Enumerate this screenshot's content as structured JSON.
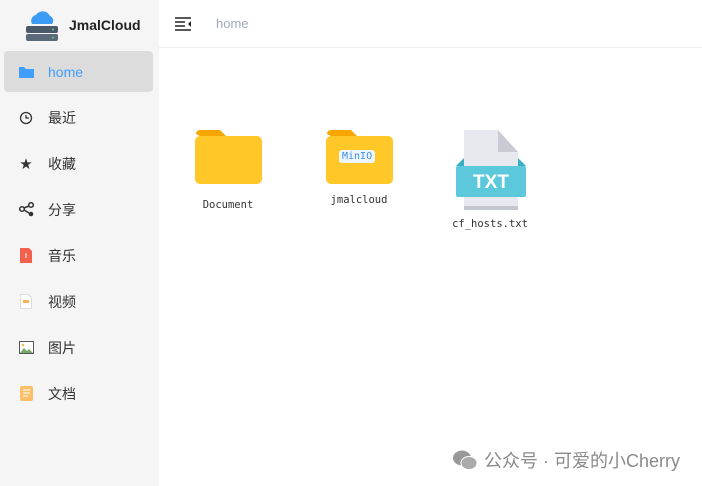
{
  "app": {
    "title": "JmalCloud"
  },
  "header": {
    "breadcrumb": "home"
  },
  "sidebar": {
    "items": [
      {
        "label": "home",
        "icon": "folder-icon"
      },
      {
        "label": "最近",
        "icon": "clock-icon"
      },
      {
        "label": "收藏",
        "icon": "star-icon"
      },
      {
        "label": "分享",
        "icon": "share-icon"
      },
      {
        "label": "音乐",
        "icon": "music-file-icon"
      },
      {
        "label": "视频",
        "icon": "video-file-icon"
      },
      {
        "label": "图片",
        "icon": "image-icon"
      },
      {
        "label": "文档",
        "icon": "document-icon"
      }
    ]
  },
  "files": [
    {
      "name": "Document",
      "type": "folder"
    },
    {
      "name": "jmalcloud",
      "type": "folder",
      "badge": "MinIO"
    },
    {
      "name": "cf_hosts.txt",
      "type": "txt",
      "badge": "TXT"
    }
  ],
  "watermark": "公众号 · 可爱的小Cherry",
  "colors": {
    "accent": "#409eff",
    "folder": "#ffc727",
    "txt": "#5bc8dc"
  }
}
